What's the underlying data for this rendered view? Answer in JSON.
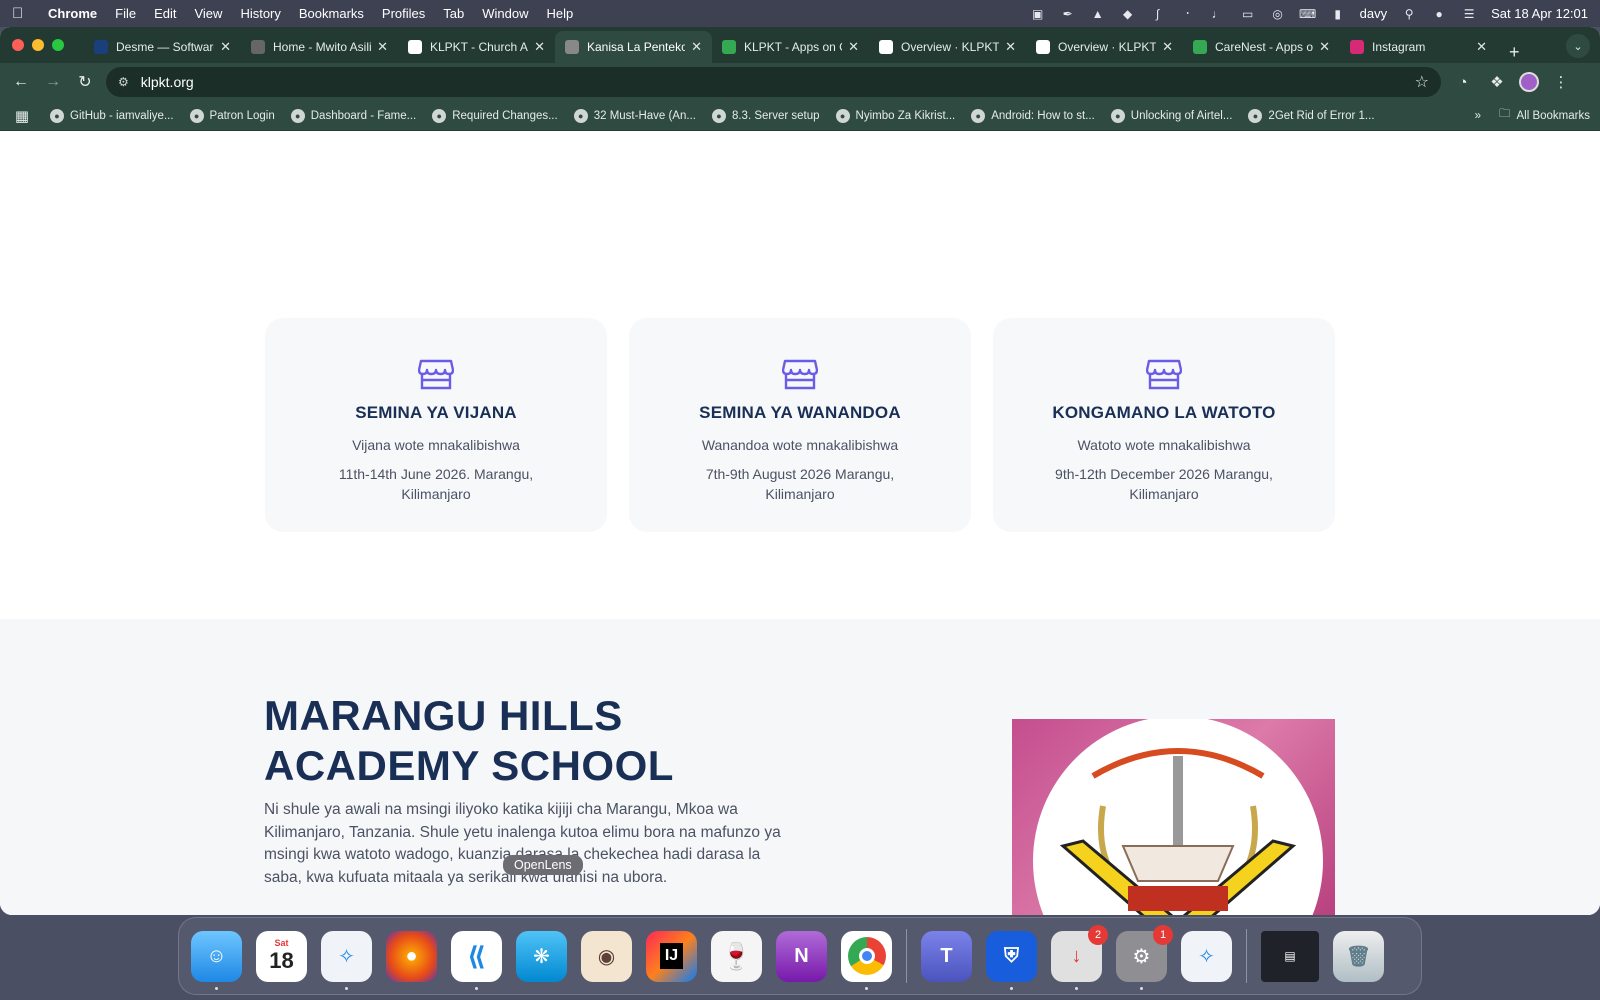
{
  "menubar": {
    "app_name": "Chrome",
    "menus": [
      "File",
      "Edit",
      "View",
      "History",
      "Bookmarks",
      "Profiles",
      "Tab",
      "Window",
      "Help"
    ],
    "user": "davy",
    "datetime": "Sat 18 Apr  12:01"
  },
  "tabs": [
    {
      "title": "Desme — Software",
      "color": "#1b3f7a"
    },
    {
      "title": "Home - Mwito Asili",
      "color": "#666666"
    },
    {
      "title": "KLPKT - Church A",
      "color": "#ffffff"
    },
    {
      "title": "Kanisa La Pentekoste",
      "color": "#888888",
      "active": true
    },
    {
      "title": "KLPKT - Apps on G",
      "color": "#34a853"
    },
    {
      "title": "Overview · KLPKT",
      "color": "#ffffff"
    },
    {
      "title": "Overview · KLPKT",
      "color": "#ffffff"
    },
    {
      "title": "CareNest - Apps o",
      "color": "#34a853"
    },
    {
      "title": "Instagram",
      "color": "#d62976"
    }
  ],
  "address": "klpkt.org",
  "bookmarks": [
    "GitHub - iamvaliye...",
    "Patron Login",
    "Dashboard - Fame...",
    "Required Changes...",
    "32 Must-Have (An...",
    "8.3. Server setup",
    "Nyimbo Za Kikrist...",
    "Android: How to st...",
    "Unlocking of Airtel...",
    "2Get Rid of Error 1..."
  ],
  "all_bookmarks_label": "All Bookmarks",
  "events": [
    {
      "title": "SEMINA YA VIJANA",
      "audience": "Vijana wote mnakalibishwa",
      "date": "11th-14th June 2026. Marangu, Kilimanjaro"
    },
    {
      "title": "SEMINA YA WANANDOA",
      "audience": "Wanandoa wote mnakalibishwa",
      "date": "7th-9th August 2026 Marangu, Kilimanjaro"
    },
    {
      "title": "KONGAMANO LA WATOTO",
      "audience": "Watoto wote mnakalibishwa",
      "date": "9th-12th December 2026 Marangu, Kilimanjaro"
    }
  ],
  "school": {
    "title": "MARANGU HILLS ACADEMY SCHOOL",
    "description": "Ni shule ya awali na msingi iliyoko katika kijiji cha Marangu, Mkoa wa Kilimanjaro, Tanzania. Shule yetu inalenga kutoa elimu bora na mafunzo ya msingi kwa watoto wadogo, kuanzia darasa la chekechea hadi darasa la saba, kwa kufuata mitaala ya serikali kwa ufanisi na ubora."
  },
  "dock_tooltip": "OpenLens",
  "calendar_day": "18",
  "calendar_weekday": "Sat",
  "dock_badges": {
    "appstore": "2",
    "settings": "1"
  }
}
